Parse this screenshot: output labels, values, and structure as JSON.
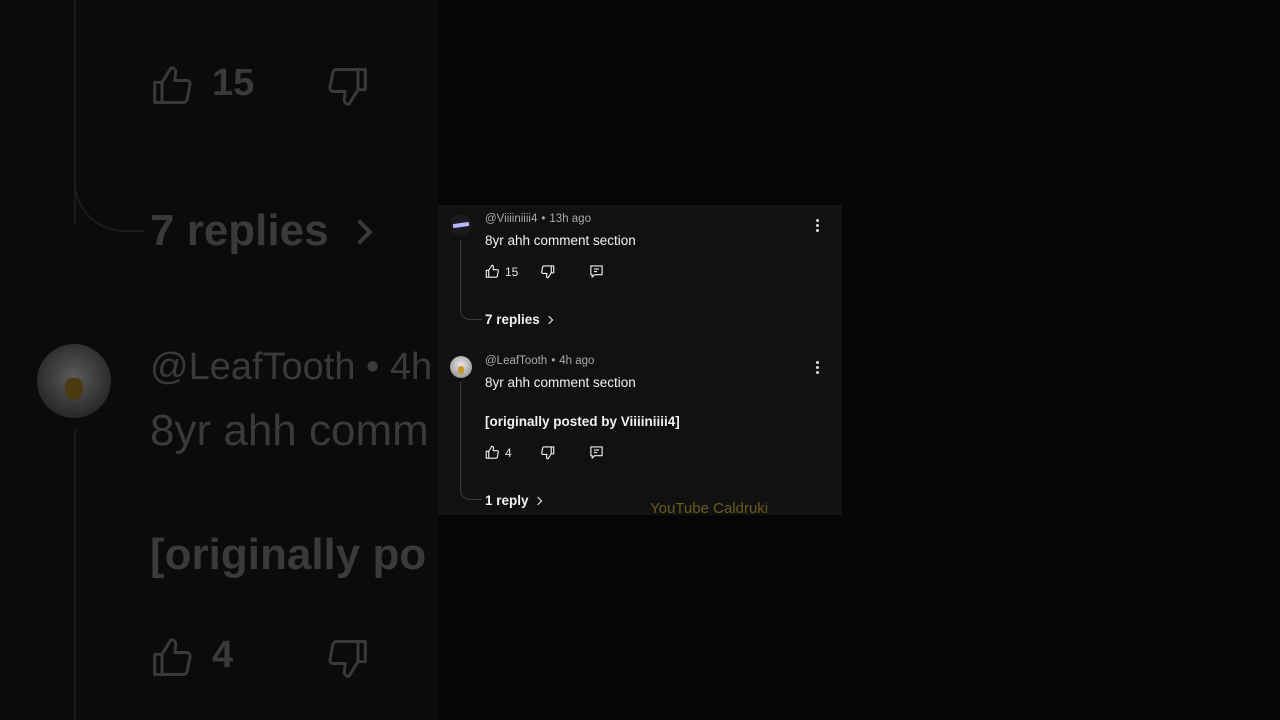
{
  "background": {
    "like_count_1": "15",
    "replies_1": "7 replies",
    "handle_2": "@LeafTooth • 4h",
    "body_2_line1": "8yr ahh comm",
    "body_2_line2": "[originally po",
    "like_count_2": "4"
  },
  "comments": [
    {
      "handle": "@Viiiiniiii4",
      "separator": "•",
      "time": "13h ago",
      "body_line1": "8yr ahh comment section",
      "likes": "15",
      "replies": "7 replies"
    },
    {
      "handle": "@LeafTooth",
      "separator": "•",
      "time": "4h ago",
      "body_line1": "8yr ahh comment section",
      "body_line2": "[originally posted by Viiiiniiii4]",
      "likes": "4",
      "replies": "1 reply"
    }
  ],
  "watermark": "YouTube Caldruki",
  "icons": {
    "like": "thumbs-up-icon",
    "dislike": "thumbs-down-icon",
    "reply": "reply-icon",
    "more": "more-vert-icon"
  },
  "colors": {
    "panel_bg": "#111111",
    "text": "#f1f1f1",
    "meta": "#aaaaaa",
    "watermark": "#6b5a1e"
  }
}
